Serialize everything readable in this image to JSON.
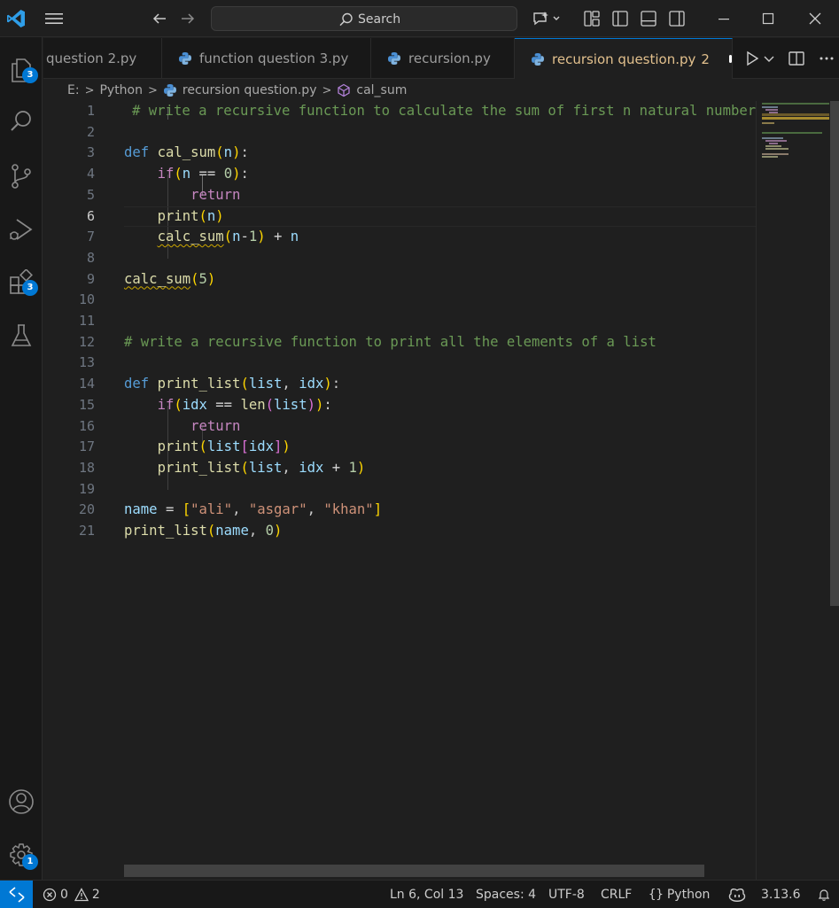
{
  "titlebar": {
    "search_placeholder": "Search"
  },
  "activity_bar": {
    "explorer_badge": "3",
    "extensions_badge": "3",
    "settings_badge": "1"
  },
  "tabs": [
    {
      "label": "question 2.py"
    },
    {
      "label": "function question 3.py"
    },
    {
      "label": "recursion.py"
    },
    {
      "label": "recursion question.py",
      "problems": "2",
      "active": true
    }
  ],
  "breadcrumb": {
    "drive": "E:",
    "folder": "Python",
    "file": "recursion question.py",
    "symbol": "cal_sum"
  },
  "editor": {
    "current_line": 6,
    "line_numbers": [
      "1",
      "2",
      "3",
      "4",
      "5",
      "6",
      "7",
      "8",
      "9",
      "10",
      "11",
      "12",
      "13",
      "14",
      "15",
      "16",
      "17",
      "18",
      "19",
      "20",
      "21"
    ],
    "code": {
      "l1_comment": "# write a recursive function to calculate the sum of first n natural numbers",
      "l3_def": "def",
      "l3_fn": "cal_sum",
      "l3_param": "n",
      "l4_if": "if",
      "l4_n": "n",
      "l4_op": " == ",
      "l4_num": "0",
      "l5_return": "return",
      "l6_print": "print",
      "l6_n": "n",
      "l7_fn": "calc_sum",
      "l7_n": "n",
      "l7_op": "-",
      "l7_num": "1",
      "l7_plus": " + ",
      "l7_n2": "n",
      "l9_fn": "calc_sum",
      "l9_num": "5",
      "l12_comment": "# write a recursive function to print all the elements of a list",
      "l14_def": "def",
      "l14_fn": "print_list",
      "l14_p1": "list",
      "l14_p2": "idx",
      "l15_if": "if",
      "l15_idx": "idx",
      "l15_op": " == ",
      "l15_len": "len",
      "l15_list": "list",
      "l16_return": "return",
      "l17_print": "print",
      "l17_list": "list",
      "l17_idx": "idx",
      "l18_fn": "print_list",
      "l18_list": "list",
      "l18_idx": "idx",
      "l18_plus": " + ",
      "l18_num": "1",
      "l20_name": "name",
      "l20_eq": " = ",
      "l20_s1": "\"ali\"",
      "l20_s2": "\"asgar\"",
      "l20_s3": "\"khan\"",
      "l21_fn": "print_list",
      "l21_name": "name",
      "l21_num": "0"
    }
  },
  "statusbar": {
    "errors": "0",
    "warnings": "2",
    "cursor": "Ln 6, Col 13",
    "spaces": "Spaces: 4",
    "encoding": "UTF-8",
    "eol": "CRLF",
    "language": "Python",
    "interpreter": "3.13.6"
  },
  "colors": {
    "accent": "#0078d4",
    "modified_tab": "#e2c08d",
    "comment": "#6a9955",
    "keyword": "#569cd6",
    "function": "#dcdcaa"
  }
}
